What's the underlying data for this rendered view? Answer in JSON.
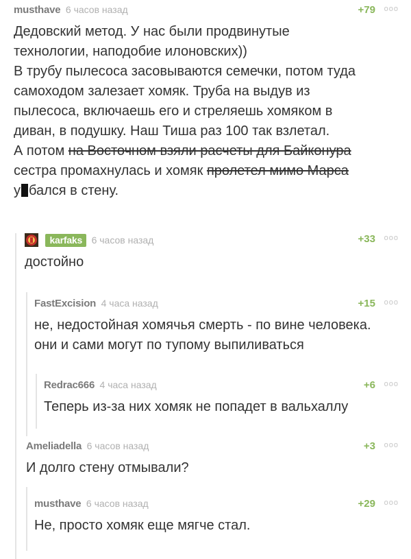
{
  "comments": {
    "c1": {
      "user": "musthave",
      "time": "6 часов назад",
      "rating": "+79",
      "dots": "ooo",
      "lines": {
        "l1": "Дедовский метод. У нас были продвинутые",
        "l2": "технологии, наподобие илоновских))",
        "l3": "В трубу пылесоса засовываются семечки, потом туда",
        "l4": "самоходом залезает хомяк. Труба на выдув из",
        "l5": "пылесоса, включаешь его и стреляешь хомяком в",
        "l6": "диван, в подушку. Наш Тиша раз 100 так взлетал.",
        "l7a": "А потом ",
        "l7b": "на Восточном взяли расчеты для Байконура",
        "l8a": "сестра промахнулась и хомяк ",
        "l8b": "пролетел мимо Марса",
        "l9a": "у",
        "l9b": "бался в стену."
      }
    },
    "c2": {
      "user": "karfaks",
      "time": "6 часов назад",
      "rating": "+33",
      "dots": "ooo",
      "text": "достойно"
    },
    "c3": {
      "user": "FastExcision",
      "time": "4 часа назад",
      "rating": "+15",
      "dots": "ooo",
      "line1": "не, недостойная хомячья смерть - по вине человека.",
      "line2": "они и сами могут по тупому выпиливаться"
    },
    "c4": {
      "user": "Redrac666",
      "time": "4 часа назад",
      "rating": "+6",
      "dots": "ooo",
      "text": "Теперь из-за них хомяк не попадет в вальхаллу"
    },
    "c5": {
      "user": "Ameliadella",
      "time": "6 часов назад",
      "rating": "+3",
      "dots": "ooo",
      "text": "И долго стену отмывали?"
    },
    "c6": {
      "user": "musthave",
      "time": "6 часов назад",
      "rating": "+29",
      "dots": "ooo",
      "text": "Не, просто хомяк еще мягче стал."
    }
  },
  "colors": {
    "rating": "#8ab75b",
    "username": "#7a7a7a",
    "time": "#b0b0b0",
    "thread_line": "#e4e4e4"
  }
}
